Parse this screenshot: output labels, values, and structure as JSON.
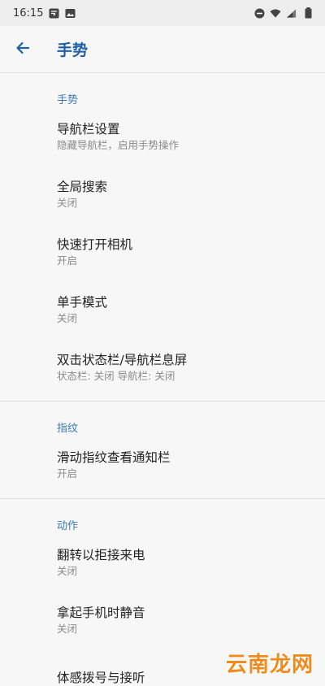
{
  "status_bar": {
    "time": "16:15"
  },
  "app_bar": {
    "title": "手势"
  },
  "sections": [
    {
      "header": "手势",
      "items": [
        {
          "title": "导航栏设置",
          "summary": "隐藏导航栏，启用手势操作"
        },
        {
          "title": "全局搜索",
          "summary": "关闭"
        },
        {
          "title": "快速打开相机",
          "summary": "开启"
        },
        {
          "title": "单手模式",
          "summary": "关闭"
        },
        {
          "title": "双击状态栏/导航栏息屏",
          "summary": "状态栏: 关闭 导航栏: 关闭"
        }
      ]
    },
    {
      "header": "指纹",
      "items": [
        {
          "title": "滑动指纹查看通知栏",
          "summary": "开启"
        }
      ]
    },
    {
      "header": "动作",
      "items": [
        {
          "title": "翻转以拒接来电",
          "summary": "关闭"
        },
        {
          "title": "拿起手机时静音",
          "summary": "关闭"
        },
        {
          "title": "体感拨号与接听",
          "summary": ""
        }
      ]
    }
  ],
  "watermark": "云南龙网",
  "colors": {
    "accent": "#1f5fa6",
    "section_header": "#3a78b8",
    "background": "#f7f7f7"
  }
}
